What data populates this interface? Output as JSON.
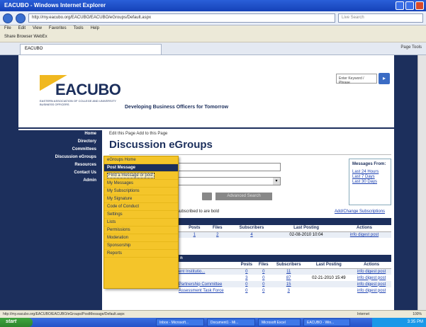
{
  "browser": {
    "window_title": "EACUBO - Windows Internet Explorer",
    "url": "http://my.eacubo.org/EACUBO/EACUBO/eGroups/Default.aspx",
    "search_placeholder": "Live Search",
    "menu": [
      "File",
      "Edit",
      "View",
      "Favorites",
      "Tools",
      "Help"
    ],
    "links_bar": "Share Browser   WebEx",
    "tab_title": "EACUBO",
    "command_bar": "Page   Tools",
    "status_url": "http://my.eacubo.org/EACUBO/EACUBO/eGroups/PostMessage/Default.aspx",
    "status_zone": "Internet",
    "zoom": "100%"
  },
  "header": {
    "logo_text": "EACUBO",
    "logo_sub": "Eastern Association of College and University Business Officers",
    "tagline": "Developing Business Officers for Tomorrow",
    "search_placeholder": "Enter Keyword / Phrase"
  },
  "leftnav": {
    "items": [
      "Home",
      "Directory",
      "Committees",
      "Discussion eGroups",
      "Resources",
      "Contact Us",
      "Admin"
    ]
  },
  "content": {
    "tools": "Edit this Page    Add to this Page",
    "title": "Discussion eGroups",
    "search_button": "Go",
    "advanced_search": "Advanced Search",
    "recent_title": "Messages From:",
    "recent_links": [
      "Last 24 Hours",
      "Last 7 Days",
      "Last 30 Days"
    ],
    "subs_note": "subscribed to are bold",
    "subs_link": "Add/Change Subscriptions"
  },
  "table1": {
    "headers": [
      "",
      "Posts",
      "Files",
      "Subscribers",
      "Last Posting",
      "Actions"
    ],
    "rows": [
      {
        "name": "",
        "posts": "1",
        "files": "2",
        "subscribers": "4",
        "last": "02-08-2010 10:04",
        "actions": "info digest post"
      }
    ]
  },
  "table2": {
    "title": "n",
    "headers": [
      "",
      "Posts",
      "Files",
      "Subscribers",
      "Last Posting",
      "Actions"
    ],
    "rows": [
      {
        "name": "ent Institutio...",
        "posts": "0",
        "files": "0",
        "subscribers": "11",
        "last": "",
        "actions": "info digest post"
      },
      {
        "name": "",
        "posts": "3",
        "files": "0",
        "subscribers": "87",
        "last": "02-21-2010 15:49",
        "actions": "info digest post"
      },
      {
        "name": "Partnership Committee",
        "posts": "0",
        "files": "0",
        "subscribers": "15",
        "last": "",
        "actions": "info digest post"
      },
      {
        "name": "Assessment Task Force",
        "posts": "0",
        "files": "0",
        "subscribers": "3",
        "last": "",
        "actions": "info digest post"
      }
    ]
  },
  "dropdown": {
    "items": [
      "eGroups Home",
      "Post Message",
      "Find a message or post",
      "My Messages",
      "My Subscriptions",
      "My Signature",
      "Code of Conduct",
      "Settings",
      "Lists",
      "Permissions",
      "Moderation",
      "Sponsorship",
      "Reports"
    ]
  },
  "taskbar": {
    "start": "start",
    "tasks": [
      "Inbox - Microsoft...",
      "Document1 - Mi...",
      "Microsoft Excel",
      "EACUBO - Win..."
    ],
    "clock": "3:35 PM"
  }
}
